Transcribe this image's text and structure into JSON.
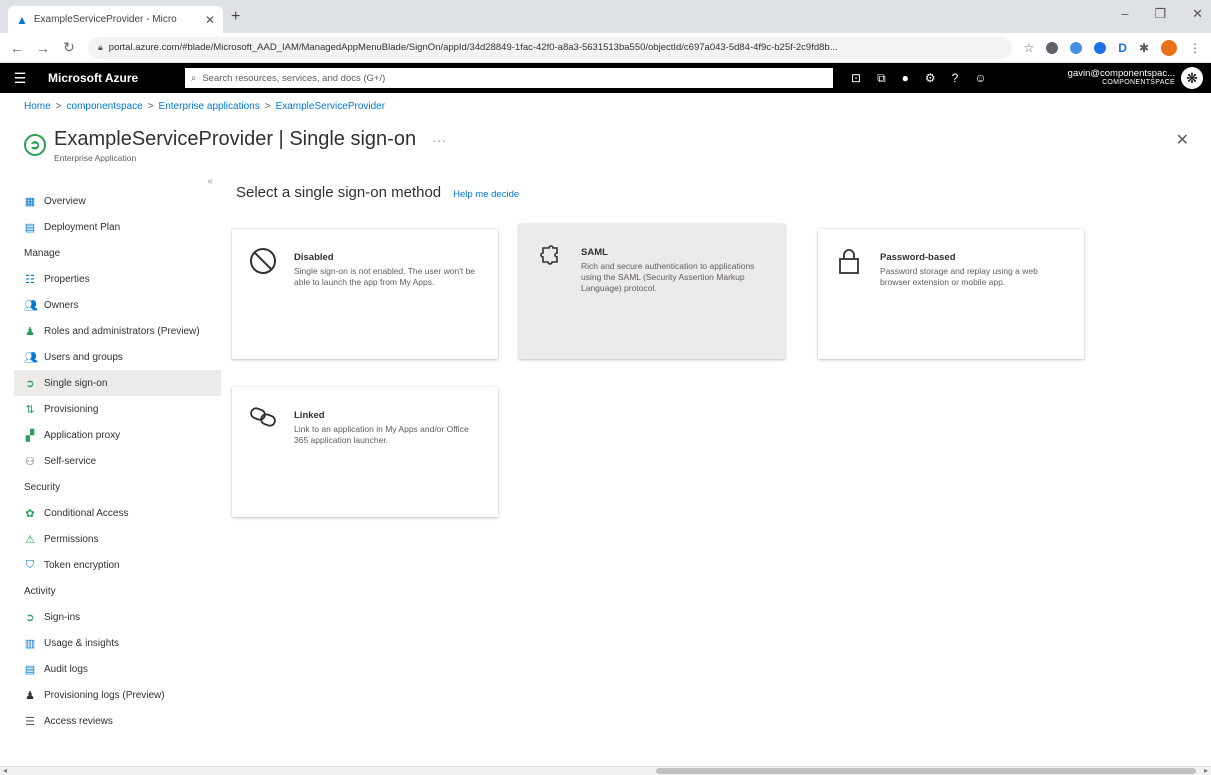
{
  "browser": {
    "tab_title": "ExampleServiceProvider - Micro",
    "url": "portal.azure.com/#blade/Microsoft_AAD_IAM/ManagedAppMenuBlade/SignOn/appId/34d28849-1fac-42f0-a8a3-5631513ba550/objectId/c697a043-5d84-4f9c-b25f-2c9fd8b..."
  },
  "azure": {
    "brand": "Microsoft Azure",
    "search_placeholder": "Search resources, services, and docs (G+/)",
    "user_email": "gavin@componentspac...",
    "user_org": "COMPONENTSPACE"
  },
  "breadcrumb": {
    "items": [
      "Home",
      "componentspace",
      "Enterprise applications",
      "ExampleServiceProvider"
    ]
  },
  "header": {
    "app_name": "ExampleServiceProvider",
    "separator": "|",
    "blade_name": "Single sign-on",
    "subtitle": "Enterprise Application",
    "more": "···"
  },
  "sidebar": {
    "items_top": [
      {
        "label": "Overview",
        "icon": "grid-icon"
      },
      {
        "label": "Deployment Plan",
        "icon": "book-icon"
      }
    ],
    "manage_label": "Manage",
    "manage_items": [
      {
        "label": "Properties",
        "icon": "properties-icon"
      },
      {
        "label": "Owners",
        "icon": "people-icon"
      },
      {
        "label": "Roles and administrators (Preview)",
        "icon": "roles-icon"
      },
      {
        "label": "Users and groups",
        "icon": "users-icon"
      },
      {
        "label": "Single sign-on",
        "icon": "sso-icon",
        "active": true
      },
      {
        "label": "Provisioning",
        "icon": "provisioning-icon"
      },
      {
        "label": "Application proxy",
        "icon": "proxy-icon"
      },
      {
        "label": "Self-service",
        "icon": "self-service-icon"
      }
    ],
    "security_label": "Security",
    "security_items": [
      {
        "label": "Conditional Access",
        "icon": "conditional-access-icon"
      },
      {
        "label": "Permissions",
        "icon": "permissions-icon"
      },
      {
        "label": "Token encryption",
        "icon": "shield-icon"
      }
    ],
    "activity_label": "Activity",
    "activity_items": [
      {
        "label": "Sign-ins",
        "icon": "sign-ins-icon"
      },
      {
        "label": "Usage & insights",
        "icon": "chart-icon"
      },
      {
        "label": "Audit logs",
        "icon": "audit-icon"
      },
      {
        "label": "Provisioning logs (Preview)",
        "icon": "person-log-icon"
      },
      {
        "label": "Access reviews",
        "icon": "list-icon"
      }
    ]
  },
  "main": {
    "heading": "Select a single sign-on method",
    "help_link": "Help me decide",
    "cards": [
      {
        "title": "Disabled",
        "description": "Single sign-on is not enabled. The user won't be able to launch the app from My Apps.",
        "icon": "disabled-icon"
      },
      {
        "title": "SAML",
        "description": "Rich and secure authentication to applications using the SAML (Security Assertion Markup Language) protocol.",
        "icon": "puzzle-icon",
        "selected": true
      },
      {
        "title": "Password-based",
        "description": "Password storage and replay using a web browser extension or mobile app.",
        "icon": "lock-icon"
      },
      {
        "title": "Linked",
        "description": "Link to an application in My Apps and/or Office 365 application launcher.",
        "icon": "link-icon"
      }
    ]
  },
  "colors": {
    "accent": "#0078d4",
    "selected_bg": "#edebe9",
    "azure_bar": "#000000",
    "sso_green": "#2a9d57"
  }
}
